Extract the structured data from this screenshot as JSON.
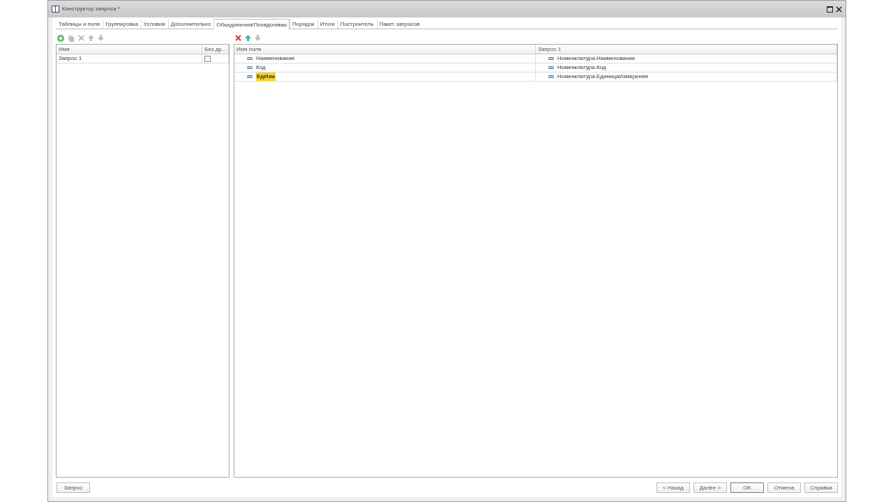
{
  "window": {
    "title": "Конструктор запроса *"
  },
  "tabs": [
    {
      "label": "Таблицы и поля",
      "selected": false
    },
    {
      "label": "Группировка",
      "selected": false
    },
    {
      "label": "Условия",
      "selected": false
    },
    {
      "label": "Дополнительно",
      "selected": false
    },
    {
      "label": "Объединения/Псевдонимы",
      "selected": true
    },
    {
      "label": "Порядок",
      "selected": false
    },
    {
      "label": "Итоги",
      "selected": false
    },
    {
      "label": "Построитель",
      "selected": false
    },
    {
      "label": "Пакет запросов",
      "selected": false
    }
  ],
  "queries_table": {
    "columns": [
      "Имя",
      "Без ду..."
    ],
    "rows": [
      {
        "name": "Запрос 1",
        "checked": false
      }
    ]
  },
  "fields_table": {
    "columns": [
      "Имя поля",
      "Запрос 1"
    ],
    "rows": [
      {
        "field": "Наименование",
        "source": "Номенклатура.Наименование",
        "selected": false
      },
      {
        "field": "Код",
        "source": "Номенклатура.Код",
        "selected": false
      },
      {
        "field": "ЕдИзм",
        "source": "Номенклатура.ЕдиницаИзмерения",
        "selected": true
      }
    ]
  },
  "footer": {
    "left_button": "Запрос",
    "buttons": [
      {
        "label": "< Назад",
        "default": false
      },
      {
        "label": "Далее >",
        "default": false
      },
      {
        "label": "OK",
        "default": true
      },
      {
        "label": "Отмена",
        "default": false
      },
      {
        "label": "Справка",
        "default": false
      }
    ]
  }
}
